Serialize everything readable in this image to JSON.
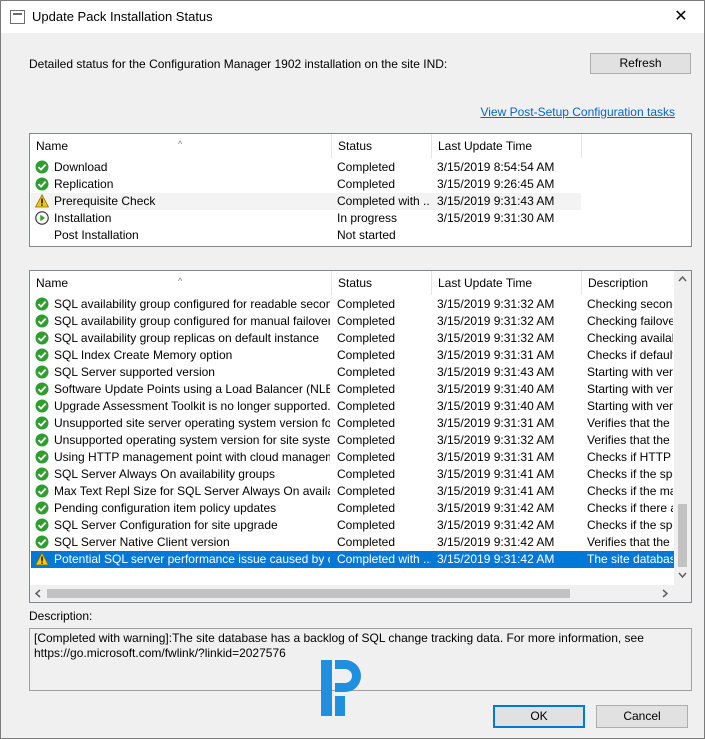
{
  "window": {
    "title": "Update Pack Installation Status",
    "close_glyph": "✕"
  },
  "detail_text": "Detailed status for the Configuration Manager 1902 installation on the site IND:",
  "refresh_label": "Refresh",
  "post_setup_link": "View Post-Setup Configuration tasks",
  "top_list": {
    "columns": [
      "Name",
      "Status",
      "Last Update Time"
    ],
    "rows": [
      {
        "icon": "check",
        "name": "Download",
        "status": "Completed",
        "time": "3/15/2019 8:54:54 AM"
      },
      {
        "icon": "check",
        "name": "Replication",
        "status": "Completed",
        "time": "3/15/2019 9:26:45 AM"
      },
      {
        "icon": "warning",
        "name": "Prerequisite Check",
        "status": "Completed with ...",
        "time": "3/15/2019 9:31:43 AM"
      },
      {
        "icon": "play",
        "name": "Installation",
        "status": "In progress",
        "time": "3/15/2019 9:31:30 AM"
      },
      {
        "icon": "none",
        "name": "Post Installation",
        "status": "Not started",
        "time": ""
      }
    ]
  },
  "bottom_list": {
    "columns": [
      "Name",
      "Status",
      "Last Update Time",
      "Description"
    ],
    "rows": [
      {
        "icon": "check",
        "name": "SQL availability group configured for readable secondaries",
        "status": "Completed",
        "time": "3/15/2019 9:31:32 AM",
        "desc": "Checking seconda"
      },
      {
        "icon": "check",
        "name": "SQL availability group configured for manual failover",
        "status": "Completed",
        "time": "3/15/2019 9:31:32 AM",
        "desc": "Checking failover"
      },
      {
        "icon": "check",
        "name": "SQL availability group replicas on default instance",
        "status": "Completed",
        "time": "3/15/2019 9:31:32 AM",
        "desc": "Checking availabi"
      },
      {
        "icon": "check",
        "name": "SQL Index Create Memory option",
        "status": "Completed",
        "time": "3/15/2019 9:31:31 AM",
        "desc": "Checks if default v"
      },
      {
        "icon": "check",
        "name": "SQL Server supported version",
        "status": "Completed",
        "time": "3/15/2019 9:31:43 AM",
        "desc": "Starting with versic"
      },
      {
        "icon": "check",
        "name": "Software Update Points using a Load Balancer (NLB/HL...",
        "status": "Completed",
        "time": "3/15/2019 9:31:40 AM",
        "desc": "Starting with versic"
      },
      {
        "icon": "check",
        "name": "Upgrade Assessment Toolkit is no longer supported.",
        "status": "Completed",
        "time": "3/15/2019 9:31:40 AM",
        "desc": "Starting with versic"
      },
      {
        "icon": "check",
        "name": "Unsupported site server operating system version for Set...",
        "status": "Completed",
        "time": "3/15/2019 9:31:31 AM",
        "desc": "Verifies that the sit"
      },
      {
        "icon": "check",
        "name": "Unsupported operating system version for site system role",
        "status": "Completed",
        "time": "3/15/2019 9:31:32 AM",
        "desc": "Verifies that the sit"
      },
      {
        "icon": "check",
        "name": "Using HTTP management point with cloud management ...",
        "status": "Completed",
        "time": "3/15/2019 9:31:31 AM",
        "desc": "Checks if HTTP"
      },
      {
        "icon": "check",
        "name": "SQL Server Always On availability groups",
        "status": "Completed",
        "time": "3/15/2019 9:31:41 AM",
        "desc": "Checks if the spec"
      },
      {
        "icon": "check",
        "name": "Max Text Repl Size for SQL Server Always On availabilit...",
        "status": "Completed",
        "time": "3/15/2019 9:31:41 AM",
        "desc": "Checks if the max"
      },
      {
        "icon": "check",
        "name": "Pending configuration item policy updates",
        "status": "Completed",
        "time": "3/15/2019 9:31:42 AM",
        "desc": "Checks if there are"
      },
      {
        "icon": "check",
        "name": "SQL Server Configuration for site upgrade",
        "status": "Completed",
        "time": "3/15/2019 9:31:42 AM",
        "desc": "Checks if the spec"
      },
      {
        "icon": "check",
        "name": "SQL Server Native Client version",
        "status": "Completed",
        "time": "3/15/2019 9:31:42 AM",
        "desc": "Verifies that the ve"
      },
      {
        "icon": "warning",
        "name": "Potential SQL server performance issue caused by chan...",
        "status": "Completed with ...",
        "time": "3/15/2019 9:31:42 AM",
        "desc": "The site database"
      }
    ]
  },
  "description_label": "Description:",
  "description_text": "[Completed with warning]:The site database has a backlog of SQL change tracking data. For more information, see https://go.microsoft.com/fwlink/?linkid=2027576",
  "ok_label": "OK",
  "cancel_label": "Cancel",
  "colors": {
    "accent": "#0078d7",
    "check_green": "#2e9f2e",
    "warning_yellow": "#f2c811",
    "link_blue": "#0066cc",
    "logo_blue": "#1f8fe0"
  }
}
